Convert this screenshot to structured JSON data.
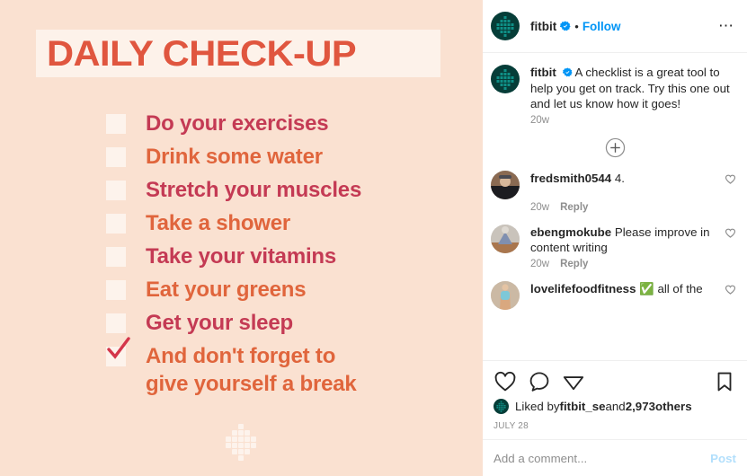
{
  "post_image": {
    "bg_color": "#fae1d1",
    "title": "DAILY CHECK-UP",
    "title_color": "#e0563f",
    "title_band_color": "#fdf2ea",
    "checkbox_color": "#fdf3ec",
    "checkmark_color": "#d4354a",
    "logo_name": "fitbit-dot-logo",
    "items": [
      {
        "label": "Do your exercises",
        "color": "#c43a54",
        "checked": false
      },
      {
        "label": "Drink some water",
        "color": "#e0653c",
        "checked": false
      },
      {
        "label": "Stretch your muscles",
        "color": "#c43a54",
        "checked": false
      },
      {
        "label": "Take a shower",
        "color": "#e0653c",
        "checked": false
      },
      {
        "label": "Take your vitamins",
        "color": "#c43a54",
        "checked": false
      },
      {
        "label": "Eat your greens",
        "color": "#e0653c",
        "checked": false
      },
      {
        "label": "Get your sleep",
        "color": "#c43a54",
        "checked": false
      },
      {
        "label": "And don't forget to\ngive yourself a break",
        "color": "#e0653c",
        "checked": true
      }
    ]
  },
  "header": {
    "username": "fitbit",
    "verified": true,
    "separator": "•",
    "follow_label": "Follow",
    "more_icon": "more-options-icon"
  },
  "caption": {
    "username": "fitbit",
    "verified": true,
    "text": "A checklist is a great tool to help you get on track. Try this one out and let us know how it goes!",
    "timestamp": "20w"
  },
  "load_more": {
    "icon": "plus-circle-icon"
  },
  "comments": [
    {
      "username": "fredsmith0544",
      "text": "4.",
      "timestamp": "20w",
      "reply_label": "Reply",
      "like_icon": "heart-outline-icon",
      "avatar": "comment-avatar-1"
    },
    {
      "username": "ebengmokube",
      "text": "Please improve in content writing",
      "timestamp": "20w",
      "reply_label": "Reply",
      "like_icon": "heart-outline-icon",
      "avatar": "comment-avatar-2"
    },
    {
      "username": "lovelifefoodfitness",
      "text": "✅ all of the",
      "timestamp": "",
      "reply_label": "",
      "like_icon": "heart-outline-icon",
      "avatar": "comment-avatar-3"
    }
  ],
  "actions": {
    "like_icon": "heart-outline-icon",
    "comment_icon": "comment-bubble-icon",
    "share_icon": "share-paper-plane-icon",
    "save_icon": "bookmark-outline-icon"
  },
  "likes": {
    "prefix": "Liked by ",
    "liker": "fitbit_se",
    "middle": " and ",
    "count": "2,973",
    "suffix": " others"
  },
  "date": "JULY 28",
  "add_comment": {
    "placeholder": "Add a comment...",
    "value": "",
    "post_label": "Post"
  },
  "colors": {
    "accent_blue": "#0095f6",
    "post_disabled": "#b2dffc",
    "text_primary": "#262626",
    "text_secondary": "#8e8e8e",
    "divider": "#efefef",
    "brand_dark": "#063d38"
  }
}
